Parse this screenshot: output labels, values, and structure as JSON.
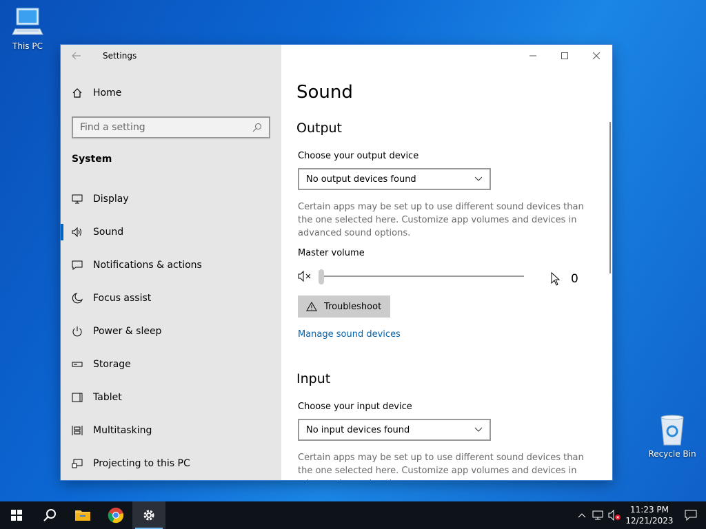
{
  "desktop": {
    "icons": [
      {
        "label": "This PC"
      },
      {
        "label": "Recycle Bin"
      }
    ]
  },
  "window": {
    "app_title": "Settings",
    "sidebar": {
      "home_label": "Home",
      "search_placeholder": "Find a setting",
      "section": "System",
      "items": [
        {
          "label": "Display",
          "icon": "display-icon"
        },
        {
          "label": "Sound",
          "icon": "speaker-icon",
          "active": true
        },
        {
          "label": "Notifications & actions",
          "icon": "notification-icon"
        },
        {
          "label": "Focus assist",
          "icon": "moon-icon"
        },
        {
          "label": "Power & sleep",
          "icon": "power-icon"
        },
        {
          "label": "Storage",
          "icon": "storage-icon"
        },
        {
          "label": "Tablet",
          "icon": "tablet-icon"
        },
        {
          "label": "Multitasking",
          "icon": "multitasking-icon"
        },
        {
          "label": "Projecting to this PC",
          "icon": "projecting-icon"
        }
      ]
    },
    "content": {
      "title": "Sound",
      "output": {
        "heading": "Output",
        "device_label": "Choose your output device",
        "device_value": "No output devices found",
        "note": "Certain apps may be set up to use different sound devices than the one selected here. Customize app volumes and devices in advanced sound options.",
        "volume_label": "Master volume",
        "volume_value": "0",
        "troubleshoot_label": "Troubleshoot",
        "manage_link": "Manage sound devices"
      },
      "input": {
        "heading": "Input",
        "device_label": "Choose your input device",
        "device_value": "No input devices found",
        "note": "Certain apps may be set up to use different sound devices than the one selected here. Customize app volumes and devices in advanced sound options."
      }
    }
  },
  "taskbar": {
    "time": "11:23 PM",
    "date": "12/21/2023"
  },
  "colors": {
    "accent": "#0067c0",
    "link": "#0063b1",
    "taskbar": "#0d1319"
  }
}
